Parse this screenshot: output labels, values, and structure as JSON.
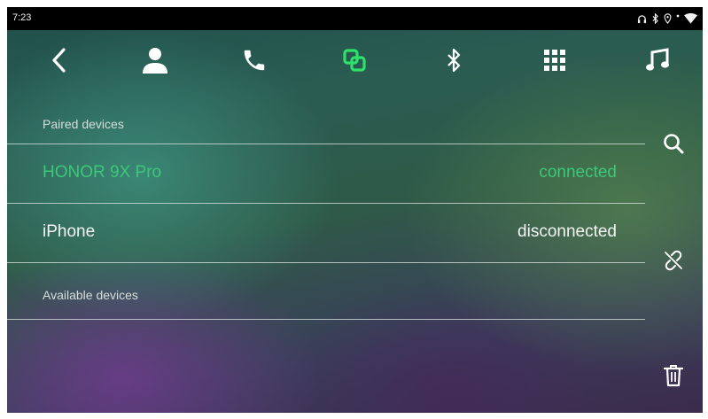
{
  "status_bar": {
    "time": "7:23",
    "icons": [
      "headset-icon",
      "bluetooth-icon",
      "location-icon",
      "signal-dot-icon",
      "wifi-icon"
    ]
  },
  "nav": {
    "items": [
      {
        "icon": "back-arrow-icon"
      },
      {
        "icon": "contacts-icon"
      },
      {
        "icon": "phone-icon"
      },
      {
        "icon": "link-icon",
        "active": true
      },
      {
        "icon": "bluetooth-icon"
      },
      {
        "icon": "dialpad-icon"
      },
      {
        "icon": "music-icon"
      }
    ]
  },
  "paired": {
    "header": "Paired devices",
    "devices": [
      {
        "name": "HONOR 9X Pro",
        "status": "connected"
      },
      {
        "name": "iPhone",
        "status": "disconnected"
      }
    ]
  },
  "available": {
    "header": "Available devices"
  },
  "side_actions": [
    "search-icon",
    "unlink-icon",
    "trash-icon"
  ],
  "colors": {
    "accent": "#3cc878",
    "text": "#f4f4f4",
    "statusbar_bg": "#000000"
  }
}
